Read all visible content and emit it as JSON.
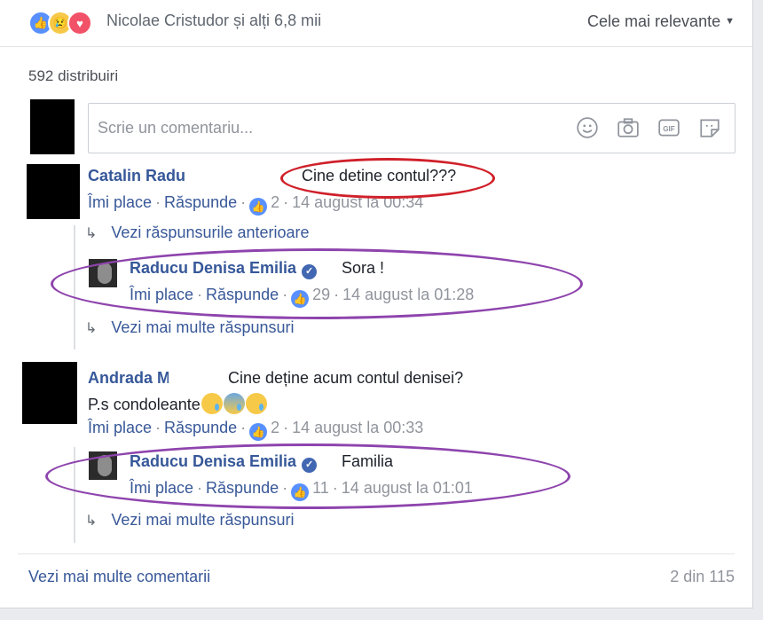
{
  "reactions": {
    "icons": [
      "like-icon",
      "sad-icon",
      "love-icon"
    ],
    "summary": "Nicolae Cristudor și alți 6,8 mii"
  },
  "sort": {
    "label": "Cele mai relevante"
  },
  "shares": {
    "label": "592 distribuiri"
  },
  "composer": {
    "placeholder": "Scrie un comentariu...",
    "icons": [
      "emoji-icon",
      "camera-icon",
      "gif-icon",
      "sticker-icon"
    ]
  },
  "comments": [
    {
      "author": "Catalin Radu",
      "text": "Cine detine contul???",
      "like_label": "Îmi place",
      "reply_label": "Răspunde",
      "likes": "2",
      "time": "14 august la 00:34",
      "prev_replies_label": "Vezi răspunsurile anterioare",
      "reply": {
        "author": "Raducu Denisa Emilia",
        "text": "Sora !",
        "like_label": "Îmi place",
        "reply_label": "Răspunde",
        "likes": "29",
        "time": "14 august la 01:28"
      },
      "more_replies_label": "Vezi mai multe răspunsuri"
    },
    {
      "author": "Andrada M",
      "text": "Cine deține acum contul denisei?",
      "text2": "P.s condoleante",
      "like_label": "Îmi place",
      "reply_label": "Răspunde",
      "likes": "2",
      "time": "14 august la 00:33",
      "reply": {
        "author": "Raducu Denisa Emilia",
        "text": "Familia",
        "like_label": "Îmi place",
        "reply_label": "Răspunde",
        "likes": "11",
        "time": "14 august la 01:01"
      },
      "more_replies_label": "Vezi mai multe răspunsuri"
    }
  ],
  "footer": {
    "more_comments": "Vezi mai multe comentarii",
    "count": "2 din 115"
  },
  "colors": {
    "link": "#385898",
    "name": "#365899",
    "highlight_red": "#d0202a",
    "highlight_purple": "#8e44ad"
  }
}
